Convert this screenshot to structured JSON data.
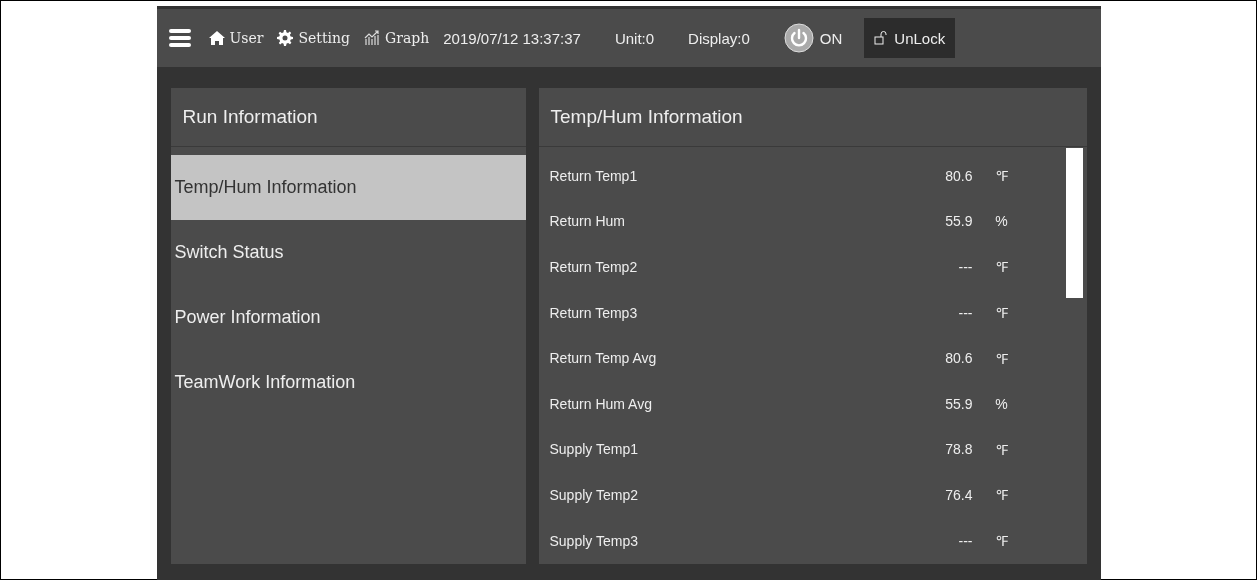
{
  "top_bar": {
    "nav": [
      {
        "kind": "user",
        "label": "User"
      },
      {
        "kind": "setting",
        "label": "Setting"
      },
      {
        "kind": "graph",
        "label": "Graph"
      }
    ],
    "datetime": "2019/07/12 13:37:37",
    "unit": "Unit:0",
    "display": "Display:0",
    "power": "ON",
    "lock": "UnLock"
  },
  "sidebar": {
    "title": "Run Information",
    "items": [
      {
        "label": "Temp/Hum Information",
        "selected": true
      },
      {
        "label": "Switch Status",
        "selected": false
      },
      {
        "label": "Power Information",
        "selected": false
      },
      {
        "label": "TeamWork Information",
        "selected": false
      }
    ]
  },
  "panel": {
    "title": "Temp/Hum Information",
    "rows": [
      {
        "name": "Return Temp1",
        "value": "80.6",
        "unit": "℉"
      },
      {
        "name": "Return Hum",
        "value": "55.9",
        "unit": "%"
      },
      {
        "name": "Return Temp2",
        "value": "---",
        "unit": "℉"
      },
      {
        "name": "Return Temp3",
        "value": "---",
        "unit": "℉"
      },
      {
        "name": "Return Temp Avg",
        "value": "80.6",
        "unit": "℉"
      },
      {
        "name": "Return Hum Avg",
        "value": "55.9",
        "unit": "%"
      },
      {
        "name": "Supply Temp1",
        "value": "78.8",
        "unit": "℉"
      },
      {
        "name": "Supply Temp2",
        "value": "76.4",
        "unit": "℉"
      },
      {
        "name": "Supply Temp3",
        "value": "---",
        "unit": "℉"
      }
    ]
  }
}
